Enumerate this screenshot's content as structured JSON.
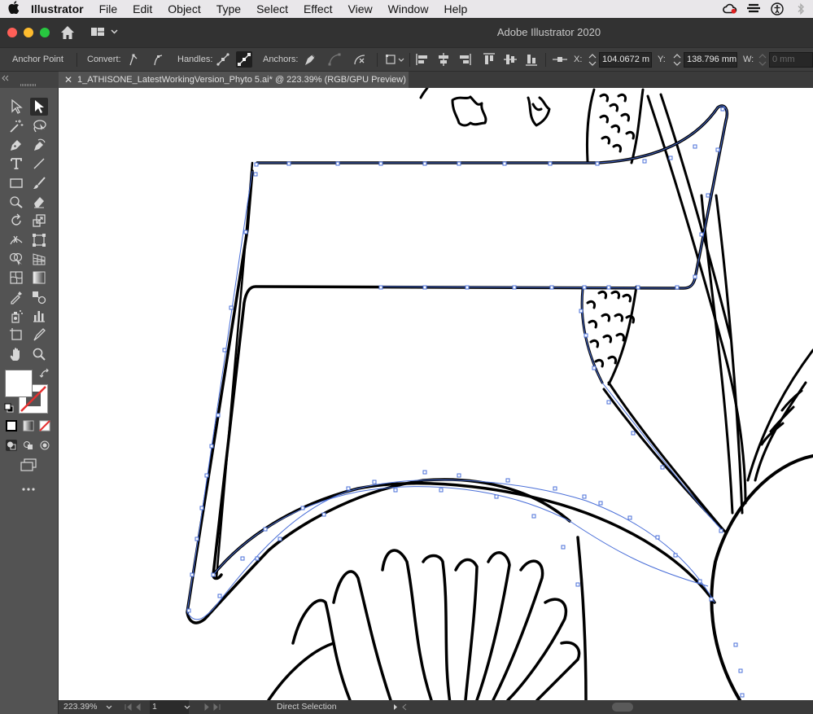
{
  "menubar": {
    "app": "Illustrator",
    "items": [
      "File",
      "Edit",
      "Object",
      "Type",
      "Select",
      "Effect",
      "View",
      "Window",
      "Help"
    ]
  },
  "window": {
    "title": "Adobe Illustrator 2020"
  },
  "control_bar": {
    "mode": "Anchor Point",
    "convert_label": "Convert:",
    "handles_label": "Handles:",
    "anchors_label": "Anchors:",
    "x_label": "X:",
    "x_value": "104.0672 m",
    "y_label": "Y:",
    "y_value": "138.796 mm",
    "w_label": "W:",
    "w_value": "0 mm"
  },
  "document": {
    "tab_title": "1_ATHISONE_LatestWorkingVersion_Phyto 5.ai* @ 223.39% (RGB/GPU Preview)",
    "close_glyph": "✕"
  },
  "status_bar": {
    "zoom": "223.39%",
    "artboard": "1",
    "tool": "Direct Selection"
  },
  "colors": {
    "selection": "#4a6fd8",
    "canvas": "#ffffff",
    "ui_dark": "#535353"
  }
}
